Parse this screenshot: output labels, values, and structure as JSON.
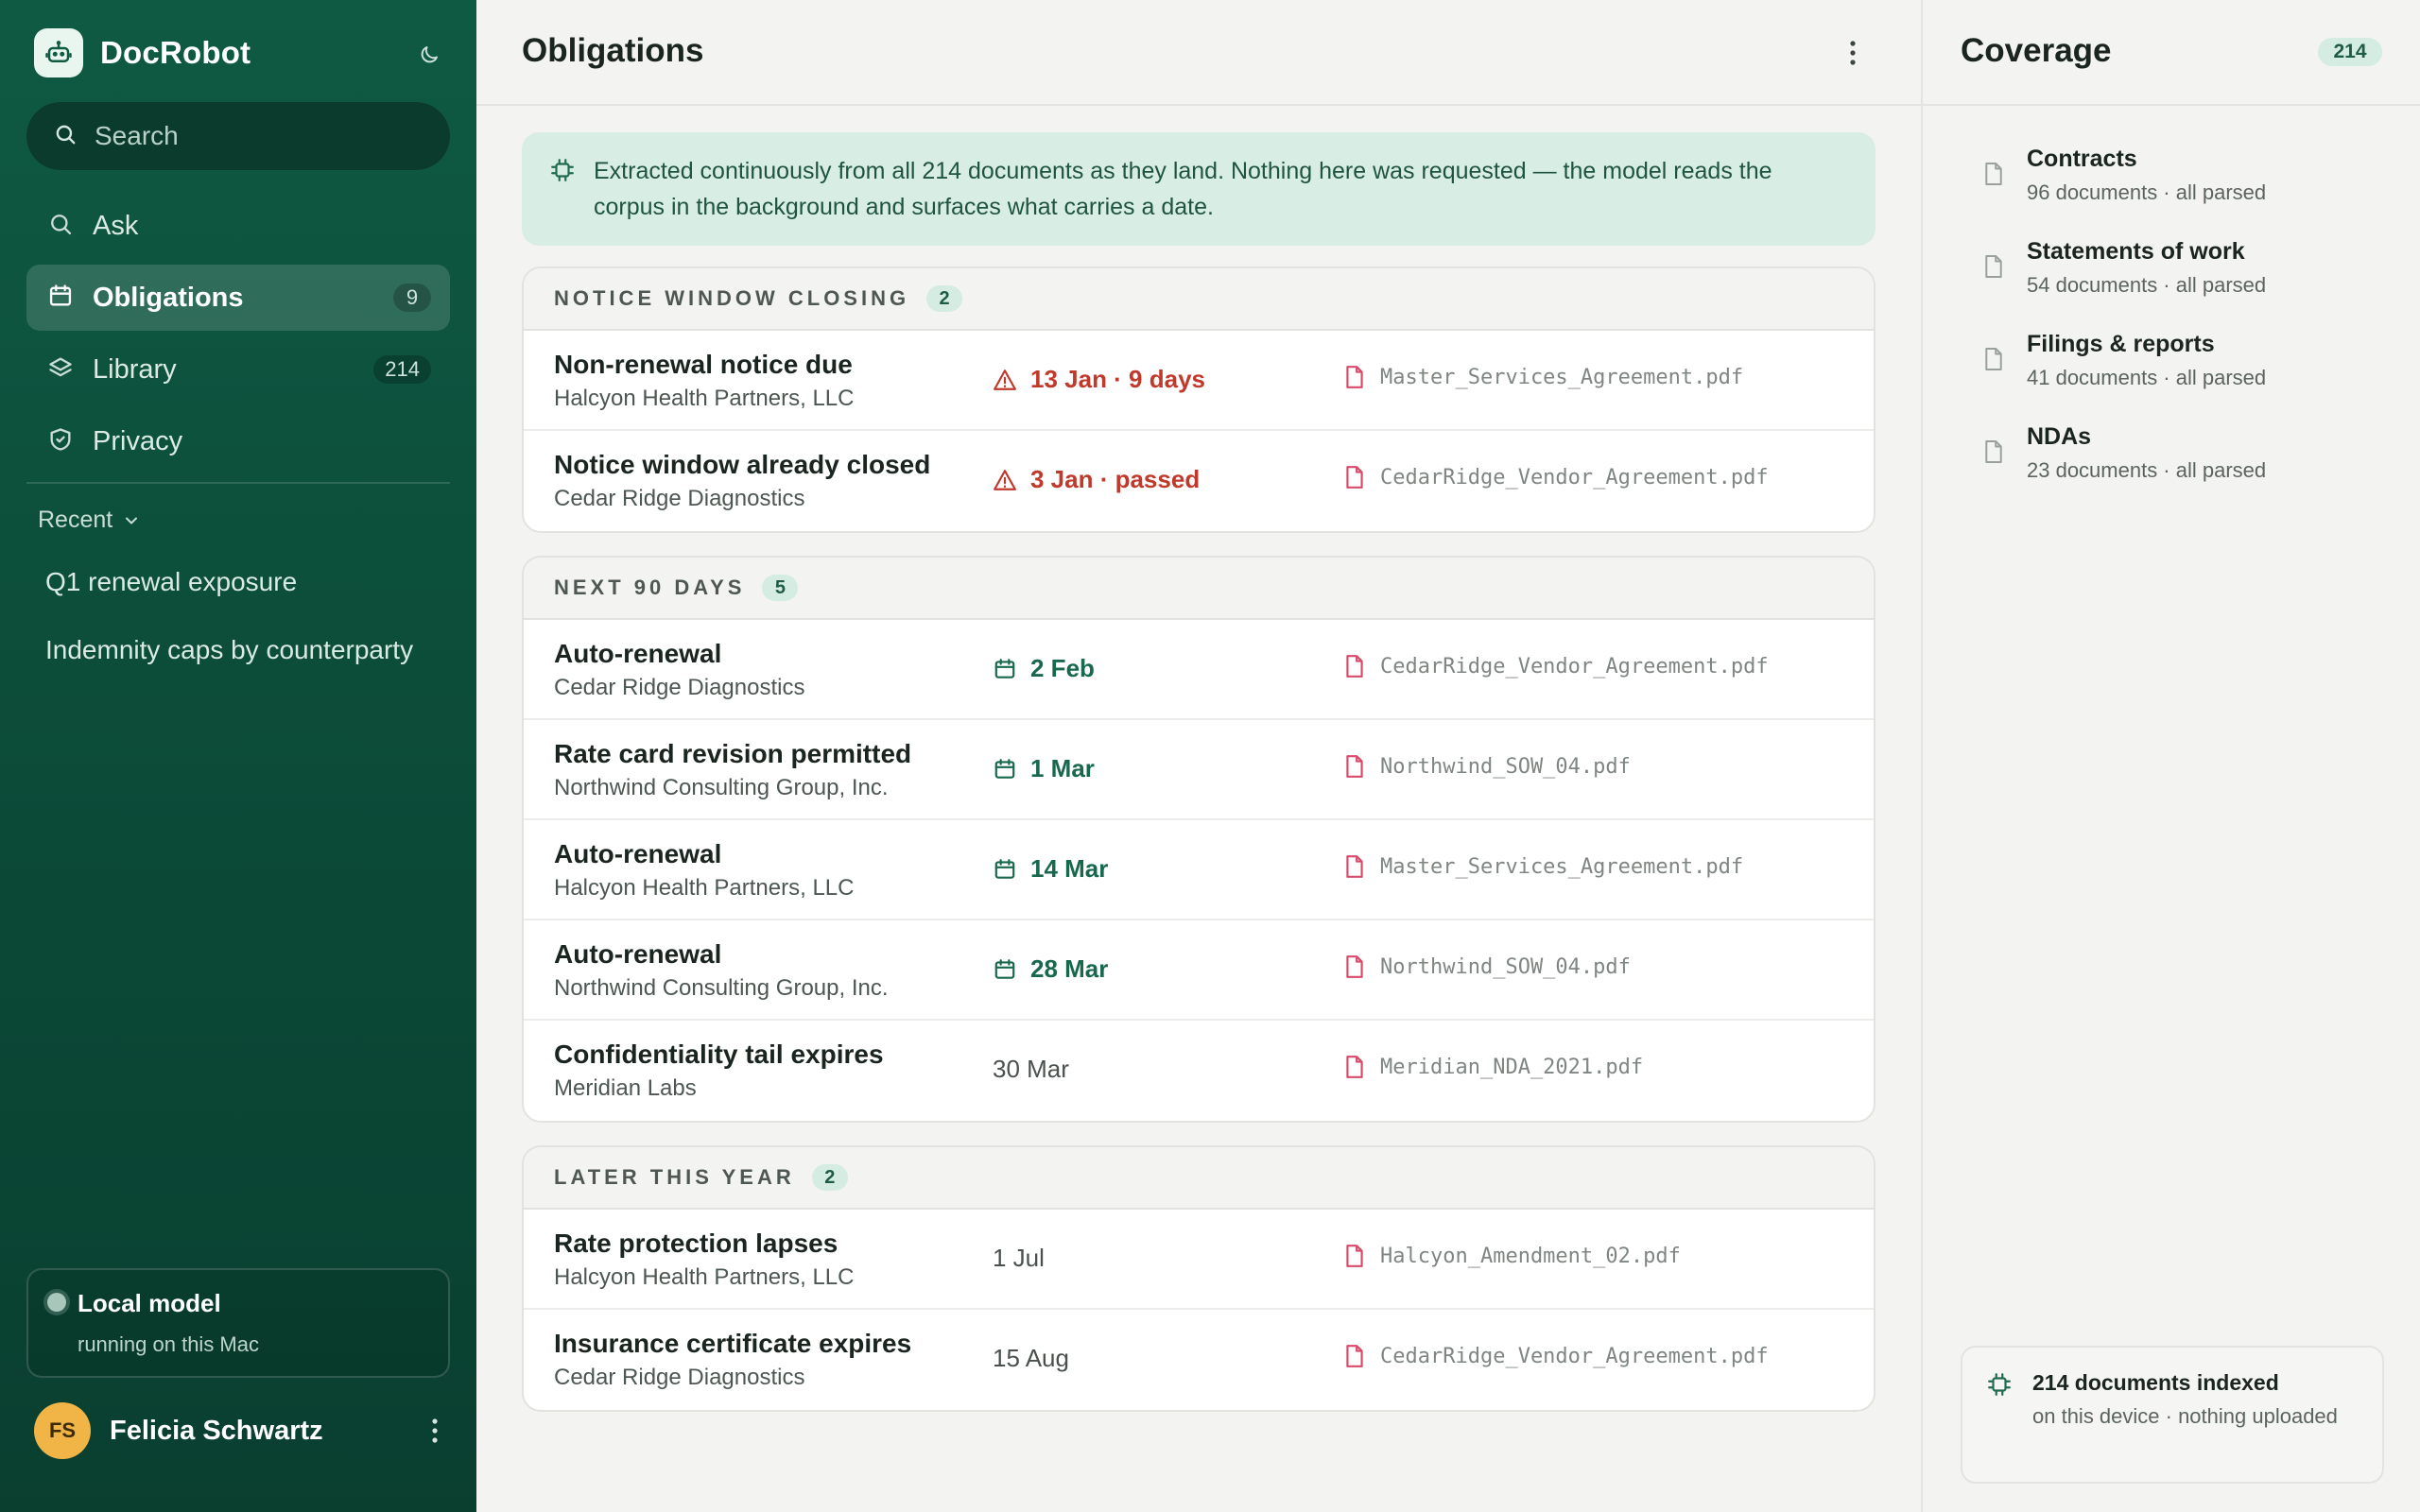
{
  "app": {
    "name": "DocRobot"
  },
  "search": {
    "placeholder": "Search"
  },
  "nav": [
    {
      "label": "Ask",
      "icon": "search-icon",
      "count": null,
      "active": false
    },
    {
      "label": "Obligations",
      "icon": "calendar-icon",
      "count": "9",
      "active": true
    },
    {
      "label": "Library",
      "icon": "layers-icon",
      "count": "214",
      "active": false
    },
    {
      "label": "Privacy",
      "icon": "shield-icon",
      "count": null,
      "active": false
    }
  ],
  "recent": {
    "label": "Recent",
    "items": [
      "Q1 renewal exposure",
      "Indemnity caps by counterparty"
    ]
  },
  "model": {
    "title": "Local model",
    "subtitle": "running on this Mac"
  },
  "user": {
    "initials": "FS",
    "name": "Felicia Schwartz"
  },
  "main": {
    "title": "Obligations",
    "banner": "Extracted continuously from all 214 documents as they land. Nothing here was requested — the model reads the corpus in the background and surfaces what carries a date."
  },
  "groups": [
    {
      "title": "NOTICE WINDOW CLOSING",
      "count": "2",
      "rows": [
        {
          "title": "Non-renewal notice due",
          "party": "Halcyon Health Partners, LLC",
          "date": "13 Jan · 9 days",
          "status": "urgent",
          "file": "Master_Services_Agreement.pdf"
        },
        {
          "title": "Notice window already closed",
          "party": "Cedar Ridge Diagnostics",
          "date": "3 Jan · passed",
          "status": "urgent",
          "file": "CedarRidge_Vendor_Agreement.pdf"
        }
      ]
    },
    {
      "title": "NEXT 90 DAYS",
      "count": "5",
      "rows": [
        {
          "title": "Auto-renewal",
          "party": "Cedar Ridge Diagnostics",
          "date": "2 Feb",
          "status": "soon",
          "file": "CedarRidge_Vendor_Agreement.pdf"
        },
        {
          "title": "Rate card revision permitted",
          "party": "Northwind Consulting Group, Inc.",
          "date": "1 Mar",
          "status": "soon",
          "file": "Northwind_SOW_04.pdf"
        },
        {
          "title": "Auto-renewal",
          "party": "Halcyon Health Partners, LLC",
          "date": "14 Mar",
          "status": "soon",
          "file": "Master_Services_Agreement.pdf"
        },
        {
          "title": "Auto-renewal",
          "party": "Northwind Consulting Group, Inc.",
          "date": "28 Mar",
          "status": "soon",
          "file": "Northwind_SOW_04.pdf"
        },
        {
          "title": "Confidentiality tail expires",
          "party": "Meridian Labs",
          "date": "30 Mar",
          "status": "plain",
          "file": "Meridian_NDA_2021.pdf"
        }
      ]
    },
    {
      "title": "LATER THIS YEAR",
      "count": "2",
      "rows": [
        {
          "title": "Rate protection lapses",
          "party": "Halcyon Health Partners, LLC",
          "date": "1 Jul",
          "status": "plain",
          "file": "Halcyon_Amendment_02.pdf"
        },
        {
          "title": "Insurance certificate expires",
          "party": "Cedar Ridge Diagnostics",
          "date": "15 Aug",
          "status": "plain",
          "file": "CedarRidge_Vendor_Agreement.pdf"
        }
      ]
    }
  ],
  "coverage": {
    "title": "Coverage",
    "count": "214",
    "items": [
      {
        "name": "Contracts",
        "detail": "96 documents · all parsed"
      },
      {
        "name": "Statements of work",
        "detail": "54 documents · all parsed"
      },
      {
        "name": "Filings & reports",
        "detail": "41 documents · all parsed"
      },
      {
        "name": "NDAs",
        "detail": "23 documents · all parsed"
      }
    ],
    "indexed": {
      "title": "214 documents indexed",
      "subtitle": "on this device · nothing uploaded"
    }
  },
  "colors": {
    "brand": "#0f5a43",
    "urgent": "#c0392b",
    "soon": "#17684d",
    "banner_bg": "#d8eee4",
    "file_icon": "#d94a6a"
  }
}
